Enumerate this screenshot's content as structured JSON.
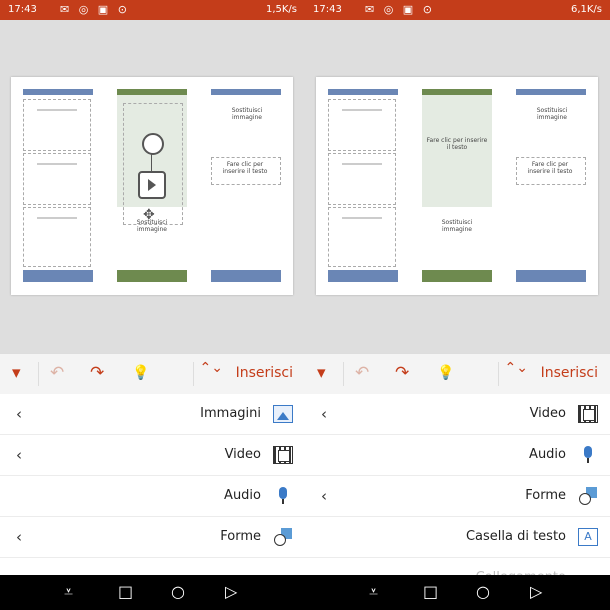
{
  "status_bar": {
    "time": "17:43",
    "icons": "✉ ◎ ▣ ⊙",
    "speed_left": "1,5K/s",
    "speed_right": "6,1K/s"
  },
  "slide_text": {
    "panel3_title": "Sostituisci immagine",
    "panel3_sub": "Fare clic per inserire il testo",
    "panel2_caption": "Sostituisci immagine",
    "panel2_inner": "Fare clic per inserire il testo"
  },
  "toolbar": {
    "tab_label": "Inserisci",
    "tab_switch_icon": "⌃⌄",
    "menu_arrow_icon": "▾",
    "undo_icon": "↶",
    "redo_icon": "↷",
    "idea_icon": "💡"
  },
  "menu_left": [
    {
      "label": "Immagini",
      "icon": "image-icon",
      "chevron": "‹"
    },
    {
      "label": "Video",
      "icon": "film-icon",
      "chevron": "‹"
    },
    {
      "label": "Audio",
      "icon": "microphone-icon",
      "chevron": ""
    },
    {
      "label": "Forme",
      "icon": "shapes-icon",
      "chevron": "‹"
    }
  ],
  "menu_right": [
    {
      "label": "Video",
      "icon": "film-icon",
      "chevron": "‹"
    },
    {
      "label": "Audio",
      "icon": "microphone-icon",
      "chevron": ""
    },
    {
      "label": "Forme",
      "icon": "shapes-icon",
      "chevron": "‹"
    },
    {
      "label": "Casella di testo",
      "icon": "textbox-icon",
      "chevron": "",
      "glyph": "A"
    },
    {
      "label": "Collegamento",
      "icon": "link-icon",
      "chevron": "‹"
    }
  ],
  "nav": {
    "menu_icon": "⩡",
    "square_icon": "□",
    "circle_icon": "○",
    "back_icon": "▷"
  },
  "colors": {
    "accent": "#c43d1a",
    "panel_blue": "#6a86b5",
    "panel_green": "#6e8a4f"
  }
}
